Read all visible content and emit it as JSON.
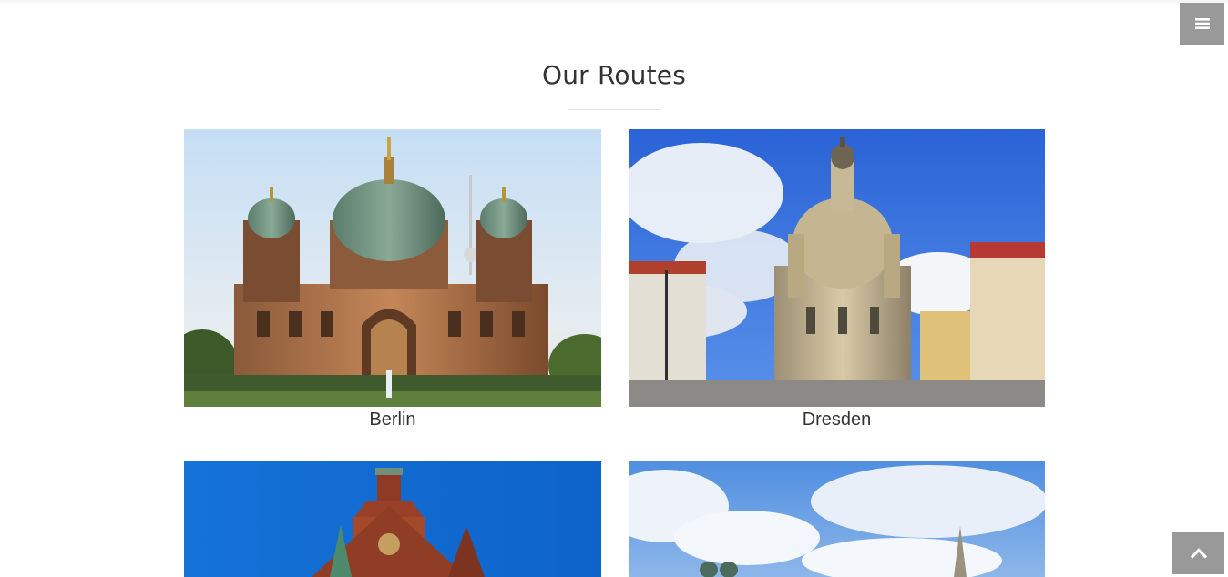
{
  "header": {
    "menu_icon": "hamburger-icon",
    "section_title": "Our Routes"
  },
  "routes": [
    {
      "city": "Berlin",
      "image": "berlin-cathedral-photo"
    },
    {
      "city": "Dresden",
      "image": "dresden-frauenkirche-photo"
    },
    {
      "city": "",
      "image": "hamburg-brick-tower-photo"
    },
    {
      "city": "",
      "image": "munich-skyline-photo"
    }
  ],
  "footer": {
    "scroll_top_icon": "chevron-up-icon"
  },
  "colors": {
    "button_bg": "#999999",
    "title_text": "#333333",
    "divider": "#e3e3e3"
  }
}
